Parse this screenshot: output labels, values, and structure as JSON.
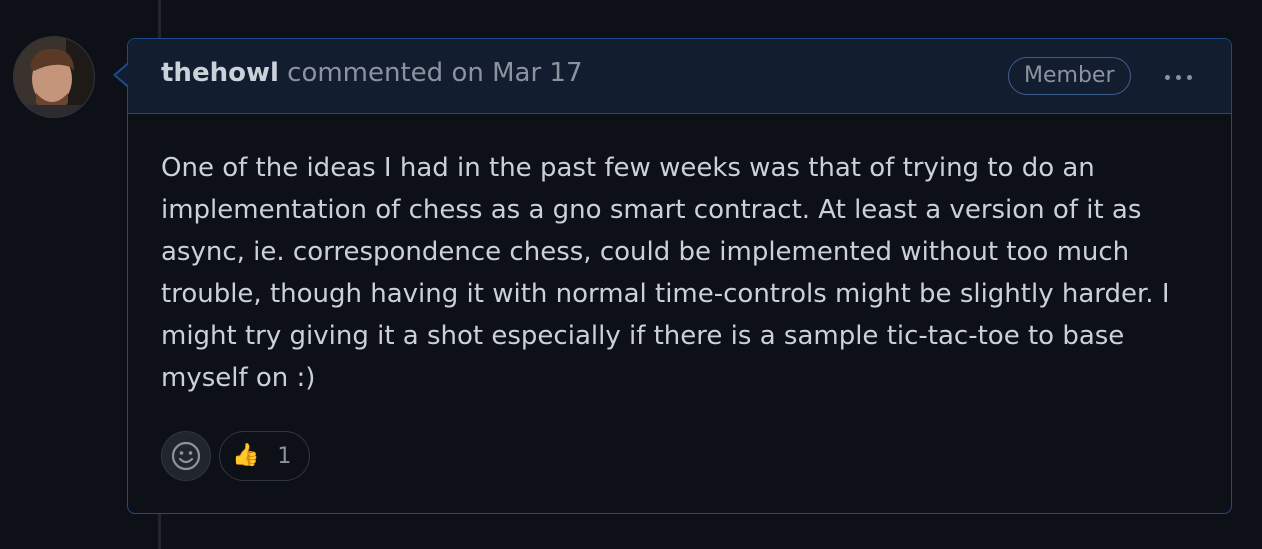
{
  "comment": {
    "author": "thehowl",
    "action_text": "commented on Mar 17",
    "badge": "Member",
    "body": "One of the ideas I had in the past few weeks was that of trying to do an implementation of chess as a gno smart contract. At least a version of it as async, ie. correspondence chess, could be implemented without too much trouble, though having it with normal time-controls might be slightly harder. I might try giving it a shot especially if there is a sample tic-tac-toe to base myself on :)",
    "reactions": [
      {
        "emoji": "👍",
        "icon": "thumbs-up-icon",
        "count": "1"
      }
    ]
  },
  "colors": {
    "background": "#0d1117",
    "header_background": "#121d2f",
    "border": "#1b4b8a",
    "text": "#c9d1d9",
    "muted_text": "#8b949e"
  }
}
